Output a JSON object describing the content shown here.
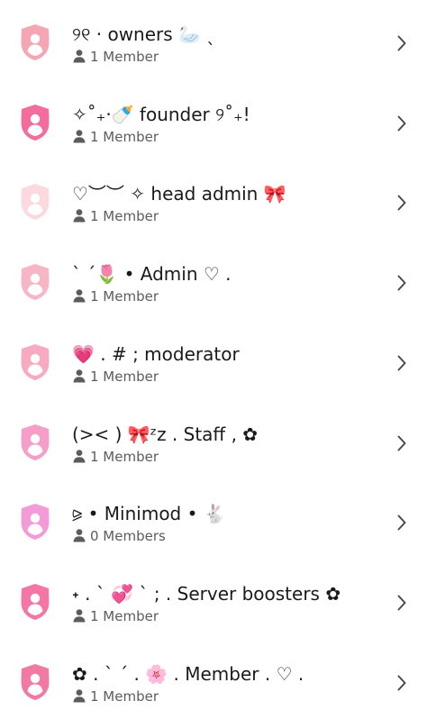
{
  "roles": [
    {
      "name": "୨୧ · owners 🦢 ˎ",
      "members": "1 Member",
      "color": "#f4a6b4"
    },
    {
      "name": "✧˚₊‧🍼 founder ୨˚₊!",
      "members": "1 Member",
      "color": "#f26d9c"
    },
    {
      "name": "♡︶︶ ✧ head admin 🎀",
      "members": "1 Member",
      "color": "#fcd9df"
    },
    {
      "name": "ˋ ˊ🌷 • Admin ♡ .",
      "members": "1 Member",
      "color": "#f7b6c5"
    },
    {
      "name": "💗 . # ; moderator",
      "members": "1 Member",
      "color": "#f8aac3"
    },
    {
      "name": "(>< ) 🎀ᶻz . Staff , ✿",
      "members": "1 Member",
      "color": "#f59ec8"
    },
    {
      "name": "⪩ • Minimod • 🐇",
      "members": "0 Members",
      "color": "#f39bd8"
    },
    {
      "name": "˖ . ` 💞 ` ; . Server boosters ✿",
      "members": "1 Member",
      "color": "#f277a6"
    },
    {
      "name": "✿ . ˋ ˊ . 🌸 . Member . ♡ .",
      "members": "1 Member",
      "color": "#f07aa3"
    }
  ],
  "icons": {
    "role": "shield-person-icon",
    "members": "person-icon",
    "chevron": "chevron-right-icon"
  },
  "colors": {
    "text": "#1a1a1a",
    "subtext": "#5c5c5c",
    "background": "#ffffff"
  }
}
